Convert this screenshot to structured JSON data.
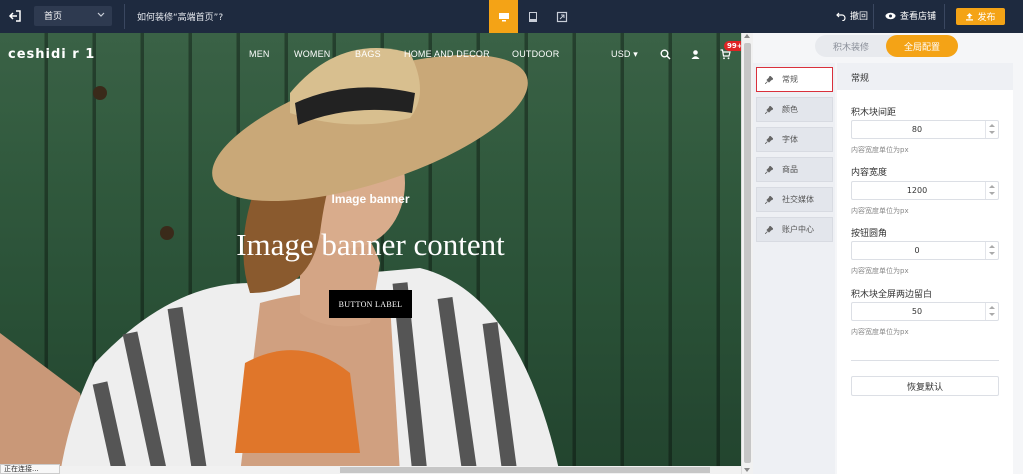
{
  "topbar": {
    "page_select": "首页",
    "howto": "如何装修“高端首页”?",
    "undo": "撤回",
    "preview": "查看店铺",
    "publish": "发布"
  },
  "store": {
    "logo": "ceshidi   r 1    ",
    "nav": [
      "MEN",
      "WOMEN",
      "BAGS",
      "HOME AND DECOR",
      "OUTDOOR"
    ],
    "currency": "USD",
    "cart_badge": "99+"
  },
  "banner": {
    "title": "Image banner",
    "content": "Image banner content",
    "button": "BUTTON LABEL"
  },
  "status_tip": "正在连接...",
  "panel": {
    "tabs": [
      "积木装修",
      "全局配置"
    ],
    "menu": [
      "常规",
      "颜色",
      "字体",
      "商品",
      "社交媒体",
      "账户中心"
    ],
    "section_title": "常规",
    "fields": [
      {
        "label": "积木块间距",
        "value": "80",
        "hint": "内容宽度单位为px"
      },
      {
        "label": "内容宽度",
        "value": "1200",
        "hint": "内容宽度单位为px"
      },
      {
        "label": "按钮圆角",
        "value": "0",
        "hint": "内容宽度单位为px"
      },
      {
        "label": "积木块全屏两边留白",
        "value": "50",
        "hint": "内容宽度单位为px"
      }
    ],
    "reset": "恢复默认"
  },
  "colors": {
    "topbar_bg": "#1e2a3f",
    "accent": "#f4a316",
    "active_border": "#d9303b"
  }
}
